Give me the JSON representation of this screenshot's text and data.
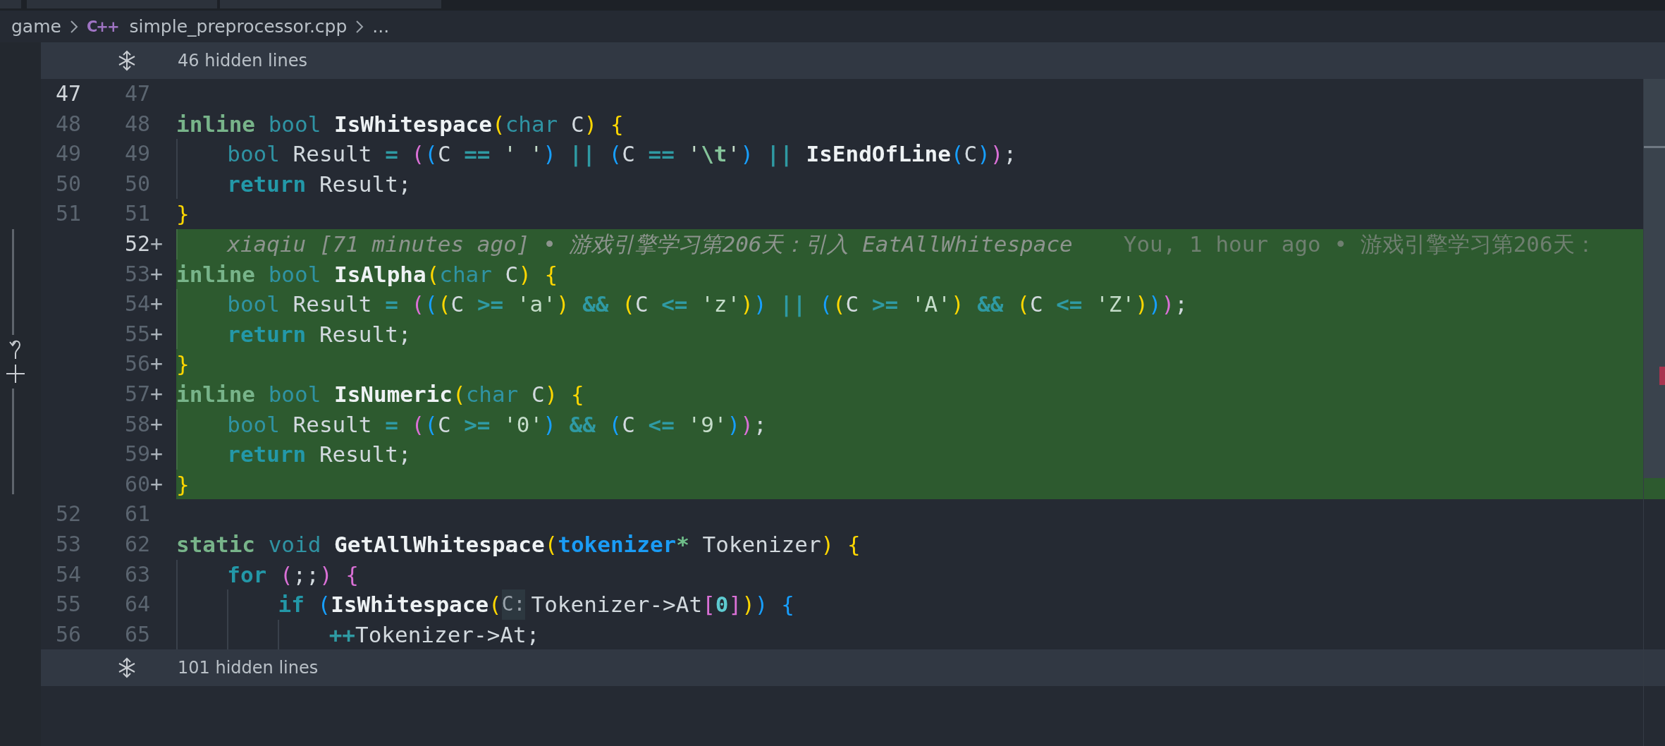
{
  "breadcrumb": [
    {
      "kind": "folder",
      "text": "game"
    },
    {
      "kind": "file",
      "icon_text": "C++",
      "text": "simple_preprocessor.cpp"
    },
    {
      "kind": "more",
      "text": "..."
    }
  ],
  "editor": {
    "fold_above": "46 hidden lines",
    "fold_below": "101 hidden lines",
    "rows": [
      {
        "old": "47",
        "new": "47",
        "current": true,
        "added": false
      },
      {
        "old": "48",
        "new": "48",
        "current": false,
        "added": false,
        "tokens": [
          {
            "kind": "kw",
            "text": "inline"
          },
          {
            "kind": "type",
            "text": " bool"
          },
          {
            "kind": "fn",
            "text": " IsWhitespace"
          },
          {
            "kind": "b1",
            "text": "("
          },
          {
            "kind": "type",
            "text": "char"
          },
          {
            "kind": "id",
            "text": " C"
          },
          {
            "kind": "b1",
            "text": ") {"
          }
        ]
      },
      {
        "old": "49",
        "new": "49",
        "current": false,
        "added": false,
        "tokens": [
          {
            "kind": "type",
            "text": "    bool"
          },
          {
            "kind": "id",
            "text": " Result"
          },
          {
            "kind": "op",
            "text": " ="
          },
          {
            "kind": "b2",
            "text": " ("
          },
          {
            "kind": "b3",
            "text": "("
          },
          {
            "kind": "id",
            "text": "C"
          },
          {
            "kind": "op",
            "text": " =="
          },
          {
            "kind": "str",
            "text": " ' '"
          },
          {
            "kind": "b3",
            "text": ")"
          },
          {
            "kind": "op",
            "text": " ||"
          },
          {
            "kind": "b3",
            "text": " ("
          },
          {
            "kind": "id",
            "text": "C"
          },
          {
            "kind": "op",
            "text": " =="
          },
          {
            "kind": "str",
            "text": " '"
          },
          {
            "kind": "esc",
            "text": "\\t"
          },
          {
            "kind": "str",
            "text": "'"
          },
          {
            "kind": "b3",
            "text": ")"
          },
          {
            "kind": "op",
            "text": " ||"
          },
          {
            "kind": "fn",
            "text": " IsEndOfLine"
          },
          {
            "kind": "b3",
            "text": "("
          },
          {
            "kind": "id",
            "text": "C"
          },
          {
            "kind": "b3",
            "text": ")"
          },
          {
            "kind": "b2",
            "text": ")"
          },
          {
            "kind": "id",
            "text": ";"
          }
        ]
      },
      {
        "old": "50",
        "new": "50",
        "current": false,
        "added": false,
        "tokens": [
          {
            "kind": "ctl",
            "text": "    return"
          },
          {
            "kind": "id",
            "text": " Result;"
          }
        ]
      },
      {
        "old": "51",
        "new": "51",
        "current": false,
        "added": false,
        "tokens": [
          {
            "kind": "b1",
            "text": "}"
          }
        ]
      },
      {
        "new": "52",
        "marker": "+",
        "current": true,
        "added": true,
        "tokens": [
          {
            "kind": "blame",
            "text": "    xiaqiu [71 minutes ago] • 游戏引擎学习第206天：引入 EatAllWhitespace"
          },
          {
            "kind": "ghost",
            "text": "You, 1 hour ago • 游戏引擎学习第206天："
          }
        ]
      },
      {
        "new": "53",
        "marker": "+",
        "current": false,
        "added": true,
        "tokens": [
          {
            "kind": "kw",
            "text": "inline"
          },
          {
            "kind": "type",
            "text": " bool"
          },
          {
            "kind": "fn",
            "text": " IsAlpha"
          },
          {
            "kind": "b1",
            "text": "("
          },
          {
            "kind": "type",
            "text": "char"
          },
          {
            "kind": "id",
            "text": " C"
          },
          {
            "kind": "b1",
            "text": ") {"
          }
        ]
      },
      {
        "new": "54",
        "marker": "+",
        "current": false,
        "added": true,
        "tokens": [
          {
            "kind": "type",
            "text": "    bool"
          },
          {
            "kind": "id",
            "text": " Result"
          },
          {
            "kind": "op",
            "text": " ="
          },
          {
            "kind": "b2",
            "text": " ("
          },
          {
            "kind": "b3",
            "text": "("
          },
          {
            "kind": "b1",
            "text": "("
          },
          {
            "kind": "id",
            "text": "C"
          },
          {
            "kind": "op",
            "text": " >="
          },
          {
            "kind": "str",
            "text": " 'a'"
          },
          {
            "kind": "b1",
            "text": ")"
          },
          {
            "kind": "op",
            "text": " &&"
          },
          {
            "kind": "b1",
            "text": " ("
          },
          {
            "kind": "id",
            "text": "C"
          },
          {
            "kind": "op",
            "text": " <="
          },
          {
            "kind": "str",
            "text": " 'z'"
          },
          {
            "kind": "b1",
            "text": ")"
          },
          {
            "kind": "b3",
            "text": ")"
          },
          {
            "kind": "op",
            "text": " ||"
          },
          {
            "kind": "b3",
            "text": " ("
          },
          {
            "kind": "b1",
            "text": "("
          },
          {
            "kind": "id",
            "text": "C"
          },
          {
            "kind": "op",
            "text": " >="
          },
          {
            "kind": "str",
            "text": " 'A'"
          },
          {
            "kind": "b1",
            "text": ")"
          },
          {
            "kind": "op",
            "text": " &&"
          },
          {
            "kind": "b1",
            "text": " ("
          },
          {
            "kind": "id",
            "text": "C"
          },
          {
            "kind": "op",
            "text": " <="
          },
          {
            "kind": "str",
            "text": " 'Z'"
          },
          {
            "kind": "b1",
            "text": ")"
          },
          {
            "kind": "b3",
            "text": ")"
          },
          {
            "kind": "b2",
            "text": ")"
          },
          {
            "kind": "id",
            "text": ";"
          }
        ]
      },
      {
        "new": "55",
        "marker": "+",
        "current": false,
        "added": true,
        "tokens": [
          {
            "kind": "ctl",
            "text": "    return"
          },
          {
            "kind": "id",
            "text": " Result;"
          }
        ]
      },
      {
        "new": "56",
        "marker": "+",
        "current": false,
        "added": true,
        "tokens": [
          {
            "kind": "b1",
            "text": "}"
          }
        ]
      },
      {
        "new": "57",
        "marker": "+",
        "current": false,
        "added": true,
        "tokens": [
          {
            "kind": "kw",
            "text": "inline"
          },
          {
            "kind": "type",
            "text": " bool"
          },
          {
            "kind": "fn",
            "text": " IsNumeric"
          },
          {
            "kind": "b1",
            "text": "("
          },
          {
            "kind": "type",
            "text": "char"
          },
          {
            "kind": "id",
            "text": " C"
          },
          {
            "kind": "b1",
            "text": ") {"
          }
        ]
      },
      {
        "new": "58",
        "marker": "+",
        "current": false,
        "added": true,
        "tokens": [
          {
            "kind": "type",
            "text": "    bool"
          },
          {
            "kind": "id",
            "text": " Result"
          },
          {
            "kind": "op",
            "text": " ="
          },
          {
            "kind": "b2",
            "text": " ("
          },
          {
            "kind": "b3",
            "text": "("
          },
          {
            "kind": "id",
            "text": "C"
          },
          {
            "kind": "op",
            "text": " >="
          },
          {
            "kind": "str",
            "text": " '0'"
          },
          {
            "kind": "b3",
            "text": ")"
          },
          {
            "kind": "op",
            "text": " &&"
          },
          {
            "kind": "b3",
            "text": " ("
          },
          {
            "kind": "id",
            "text": "C"
          },
          {
            "kind": "op",
            "text": " <="
          },
          {
            "kind": "str",
            "text": " '9'"
          },
          {
            "kind": "b3",
            "text": ")"
          },
          {
            "kind": "b2",
            "text": ")"
          },
          {
            "kind": "id",
            "text": ";"
          }
        ]
      },
      {
        "new": "59",
        "marker": "+",
        "current": false,
        "added": true,
        "tokens": [
          {
            "kind": "ctl",
            "text": "    return"
          },
          {
            "kind": "id",
            "text": " Result;"
          }
        ]
      },
      {
        "new": "60",
        "marker": "+",
        "current": false,
        "added": true,
        "tokens": [
          {
            "kind": "b1",
            "text": "}"
          }
        ]
      },
      {
        "old": "52",
        "new": "61",
        "current": false,
        "added": false
      },
      {
        "old": "53",
        "new": "62",
        "current": false,
        "added": false,
        "tokens": [
          {
            "kind": "kw",
            "text": "static"
          },
          {
            "kind": "type",
            "text": " void"
          },
          {
            "kind": "fn",
            "text": " GetAllWhitespace"
          },
          {
            "kind": "b1",
            "text": "("
          },
          {
            "kind": "utype",
            "text": "tokenizer"
          },
          {
            "kind": "ptr",
            "text": "*"
          },
          {
            "kind": "id",
            "text": " Tokenizer"
          },
          {
            "kind": "b1",
            "text": ") {"
          }
        ]
      },
      {
        "old": "54",
        "new": "63",
        "current": false,
        "added": false,
        "tokens": [
          {
            "kind": "ctl",
            "text": "    for"
          },
          {
            "kind": "b2",
            "text": " ("
          },
          {
            "kind": "id",
            "text": ";;"
          },
          {
            "kind": "b2",
            "text": ") {"
          }
        ]
      },
      {
        "old": "55",
        "new": "64",
        "current": false,
        "added": false,
        "tokens": [
          {
            "kind": "ctl",
            "text": "        if"
          },
          {
            "kind": "b3",
            "text": " ("
          },
          {
            "kind": "fn",
            "text": "IsWhitespace"
          },
          {
            "kind": "b1",
            "text": "("
          },
          {
            "kind": "hint",
            "text": "C:"
          },
          {
            "kind": "id",
            "text": "Tokenizer->At"
          },
          {
            "kind": "b2",
            "text": "["
          },
          {
            "kind": "num",
            "text": "0"
          },
          {
            "kind": "b2",
            "text": "]"
          },
          {
            "kind": "b1",
            "text": ")"
          },
          {
            "kind": "b3",
            "text": ")"
          },
          {
            "kind": "b3",
            "text": " {"
          }
        ]
      },
      {
        "old": "56",
        "new": "65",
        "current": false,
        "added": false,
        "tokens": [
          {
            "kind": "op",
            "text": "            ++"
          },
          {
            "kind": "id",
            "text": "Tokenizer->At;"
          }
        ]
      }
    ]
  }
}
